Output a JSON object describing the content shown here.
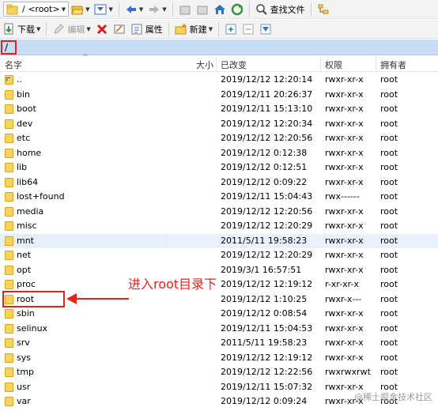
{
  "toolbar_top": {
    "path_value": "/ <root>",
    "find_files_label": "查找文件"
  },
  "toolbar_bottom": {
    "download_label": "下载",
    "edit_label": "编辑",
    "properties_label": "属性",
    "new_label": "新建"
  },
  "address": {
    "path": "/"
  },
  "columns": {
    "name": "名字",
    "size": "大小",
    "modified": "已改变",
    "permissions": "权限",
    "owner": "拥有者"
  },
  "rows": [
    {
      "name": "..",
      "modified": "2019/12/12 12:20:14",
      "permissions": "rwxr-xr-x",
      "owner": "root"
    },
    {
      "name": "bin",
      "modified": "2019/12/11 20:26:37",
      "permissions": "rwxr-xr-x",
      "owner": "root"
    },
    {
      "name": "boot",
      "modified": "2019/12/11 15:13:10",
      "permissions": "rwxr-xr-x",
      "owner": "root"
    },
    {
      "name": "dev",
      "modified": "2019/12/12 12:20:34",
      "permissions": "rwxr-xr-x",
      "owner": "root"
    },
    {
      "name": "etc",
      "modified": "2019/12/12 12:20:56",
      "permissions": "rwxr-xr-x",
      "owner": "root"
    },
    {
      "name": "home",
      "modified": "2019/12/12 0:12:38",
      "permissions": "rwxr-xr-x",
      "owner": "root"
    },
    {
      "name": "lib",
      "modified": "2019/12/12 0:12:51",
      "permissions": "rwxr-xr-x",
      "owner": "root"
    },
    {
      "name": "lib64",
      "modified": "2019/12/12 0:09:22",
      "permissions": "rwxr-xr-x",
      "owner": "root"
    },
    {
      "name": "lost+found",
      "modified": "2019/12/11 15:04:43",
      "permissions": "rwx------",
      "owner": "root"
    },
    {
      "name": "media",
      "modified": "2019/12/12 12:20:56",
      "permissions": "rwxr-xr-x",
      "owner": "root"
    },
    {
      "name": "misc",
      "modified": "2019/12/12 12:20:29",
      "permissions": "rwxr-xr-x",
      "owner": "root"
    },
    {
      "name": "mnt",
      "modified": "2011/5/11 19:58:23",
      "permissions": "rwxr-xr-x",
      "owner": "root"
    },
    {
      "name": "net",
      "modified": "2019/12/12 12:20:29",
      "permissions": "rwxr-xr-x",
      "owner": "root"
    },
    {
      "name": "opt",
      "modified": "2019/3/1 16:57:51",
      "permissions": "rwxr-xr-x",
      "owner": "root"
    },
    {
      "name": "proc",
      "modified": "2019/12/12 12:19:12",
      "permissions": "r-xr-xr-x",
      "owner": "root"
    },
    {
      "name": "root",
      "modified": "2019/12/12 1:10:25",
      "permissions": "rwxr-x---",
      "owner": "root"
    },
    {
      "name": "sbin",
      "modified": "2019/12/12 0:08:54",
      "permissions": "rwxr-xr-x",
      "owner": "root"
    },
    {
      "name": "selinux",
      "modified": "2019/12/11 15:04:53",
      "permissions": "rwxr-xr-x",
      "owner": "root"
    },
    {
      "name": "srv",
      "modified": "2011/5/11 19:58:23",
      "permissions": "rwxr-xr-x",
      "owner": "root"
    },
    {
      "name": "sys",
      "modified": "2019/12/12 12:19:12",
      "permissions": "rwxr-xr-x",
      "owner": "root"
    },
    {
      "name": "tmp",
      "modified": "2019/12/12 12:22:56",
      "permissions": "rwxrwxrwt",
      "owner": "root"
    },
    {
      "name": "usr",
      "modified": "2019/12/11 15:07:32",
      "permissions": "rwxr-xr-x",
      "owner": "root"
    },
    {
      "name": "var",
      "modified": "2019/12/12 0:09:24",
      "permissions": "rwxr-xr-x",
      "owner": "root"
    }
  ],
  "annotation": {
    "text": "进入root目录下"
  },
  "watermark": "@稀土掘金技术社区",
  "colors": {
    "annotation_red": "#e2231a",
    "address_bar": "#c8ddf6",
    "folder": "#f5d35e"
  }
}
